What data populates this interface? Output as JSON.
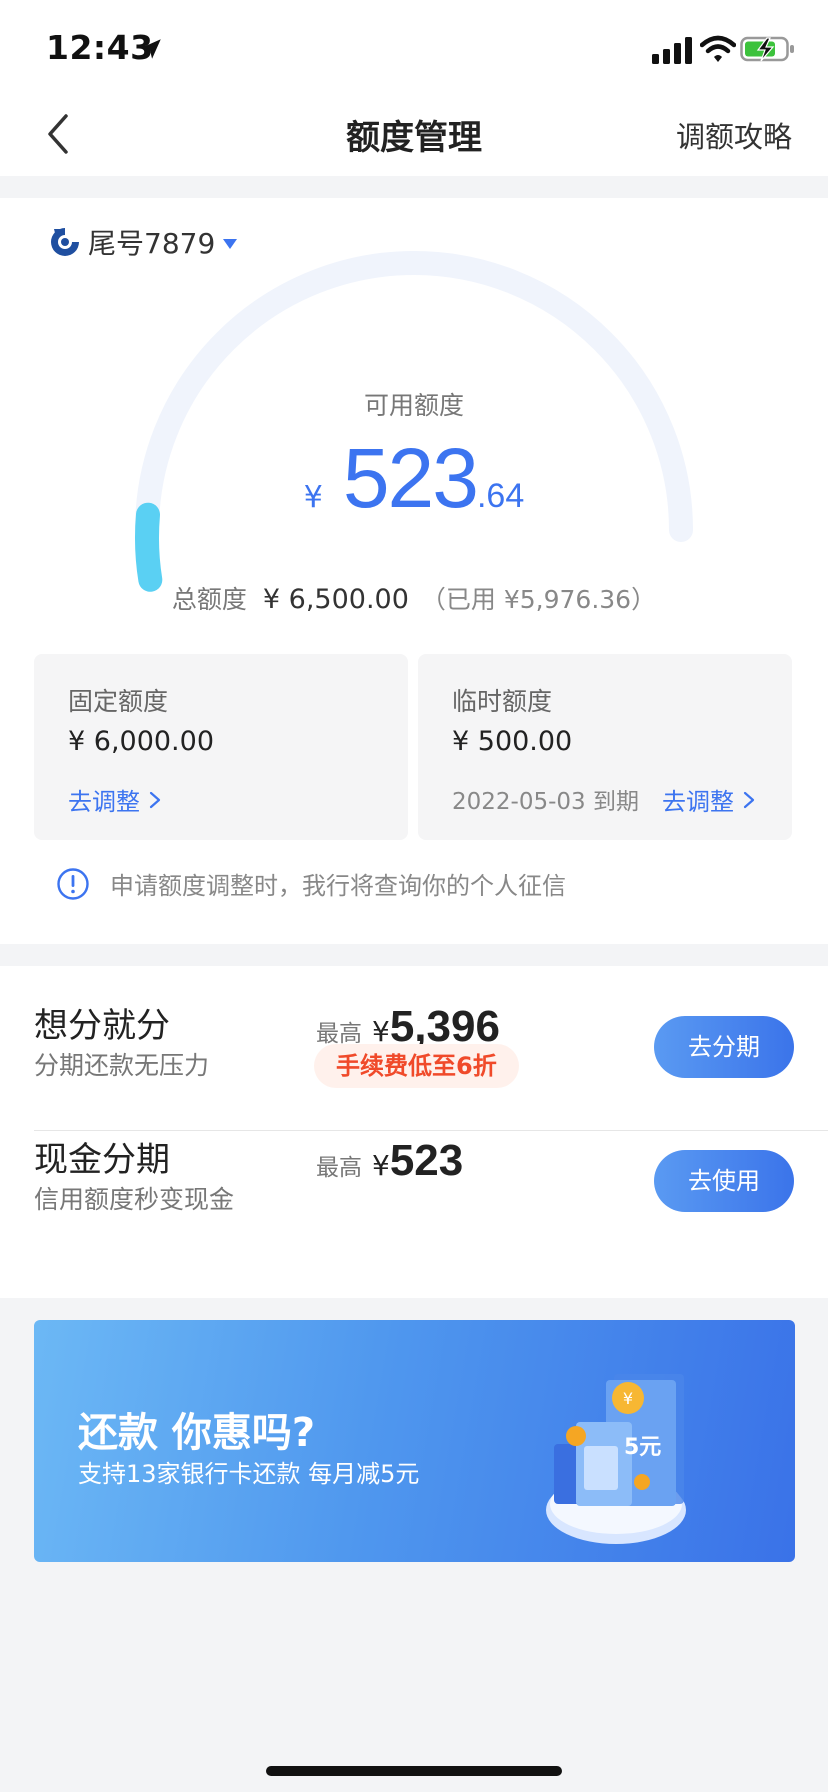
{
  "status": {
    "time": "12:43"
  },
  "nav": {
    "title": "额度管理",
    "right": "调额攻略"
  },
  "card": {
    "label": "尾号7879"
  },
  "gauge": {
    "available_label": "可用额度",
    "yen": "¥",
    "available_int": "523",
    "available_dec": ".64",
    "available_fraction": 0.081
  },
  "total": {
    "label": "总额度",
    "amount": "¥ 6,500.00",
    "used": "（已用 ¥5,976.36）"
  },
  "fixed": {
    "label": "固定额度",
    "amount": "¥ 6,000.00",
    "link": "去调整"
  },
  "temp": {
    "label": "临时额度",
    "amount": "¥ 500.00",
    "expiry": "2022-05-03 到期",
    "link": "去调整"
  },
  "notice": "申请额度调整时，我行将查询你的个人征信",
  "installment": {
    "title": "想分就分",
    "subtitle": "分期还款无压力",
    "max_label": "最高",
    "yen": "¥",
    "max_value": "5,396",
    "fee_tag": "手续费低至6折",
    "button": "去分期"
  },
  "cash": {
    "title": "现金分期",
    "subtitle": "信用额度秒变现金",
    "max_label": "最高",
    "yen": "¥",
    "max_value": "523",
    "button": "去使用"
  },
  "banner": {
    "title": "还款 你惠吗?",
    "subtitle": "支持13家银行卡还款 每月减5元",
    "art_text": "5元"
  },
  "colors": {
    "accent": "#3c74f0",
    "gauge_fill": "#5ad0f3",
    "gauge_track": "#f0f4fc",
    "fee": "#f04a2a"
  }
}
